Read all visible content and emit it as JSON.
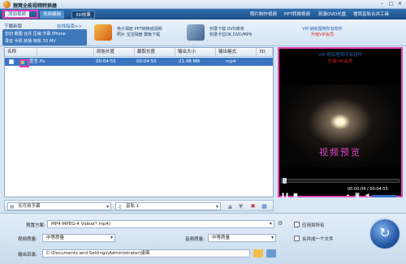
{
  "app": {
    "title": "狸窝全能视频转换器"
  },
  "tabs": [
    {
      "label": "添加视频"
    },
    {
      "label": "视频编辑"
    },
    {
      "label": "3D效果"
    }
  ],
  "top_menu": [
    "照片制作视频",
    "PPT转换视频",
    "刻录DVD光盘",
    "狸窝音轨合并工具"
  ],
  "promo": {
    "col1": [
      "电子相册  PPT转换成视频",
      "照片  宝宝相册  模板下载"
    ],
    "col2": [
      "刻录下载  DVD菜单",
      "刻录卡拉OK  DVD/MP4"
    ],
    "vip_title": "VIP-拥有狸窝所有软件",
    "vip_sub": "升级VIP会员"
  },
  "download_panel": {
    "title": "下载新版",
    "online": "在线指南>>",
    "row1": "剪切 截图 合并 压缩 字幕 iPhone",
    "row2": "录音 手机 转场 特效 3D MV"
  },
  "table": {
    "headers": [
      "名称",
      "原始长度",
      "截取长度",
      "输出大小",
      "输出格式",
      "3D"
    ],
    "rows": [
      {
        "name": "宣言.flv",
        "orig_len": "00:04:55",
        "cut_len": "00:04:55",
        "size": "21.48 MB",
        "format": "mp4",
        "three_d": ""
      }
    ]
  },
  "preview": {
    "vip_note": "VIP-拥有狸窝所有软件",
    "vip_sub": "升级VIP会员",
    "label": "视频预览",
    "time": "00:00:04 / 00:04:55"
  },
  "progress": {
    "position_fraction": 0.01
  },
  "strip": {
    "subtitle": "无可用字幕",
    "audio": "音轨 1"
  },
  "settings": {
    "preset_label": "预置方案:",
    "preset_value": "MP4-MPEG-4 Video(*.mp4)",
    "video_quality_label": "视频质量:",
    "video_quality_value": "中等质量",
    "audio_quality_label": "音频质量:",
    "audio_quality_value": "中等质量",
    "output_label": "输出目录:",
    "output_value": "C:\\Documents and Settings\\Administrator\\桌面",
    "apply_all": "应用到所有",
    "merge": "合并成一个文件"
  },
  "colors": {
    "accent": "#1d4f86",
    "highlight": "#e546b8",
    "selected_row": "#3a75c2"
  }
}
